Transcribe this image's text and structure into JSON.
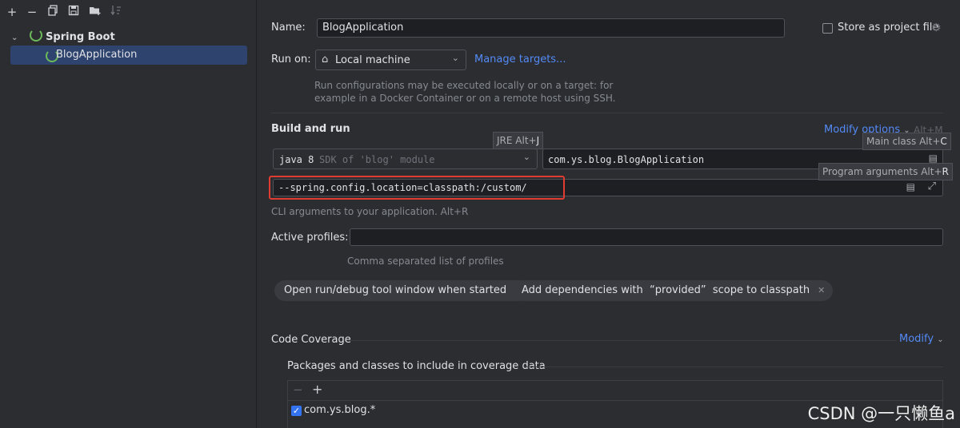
{
  "toolbar": {
    "add_icon": "+",
    "remove_icon": "−"
  },
  "tree": {
    "root_label": "Spring Boot",
    "child_label": "BlogApplication"
  },
  "form": {
    "name_label": "Name:",
    "name_value": "BlogApplication",
    "store_label": "Store as project file",
    "runon_label": "Run on:",
    "runon_value": "Local machine",
    "manage_targets": "Manage targets...",
    "runon_hint_line1": "Run configurations may be executed locally or on a target: for",
    "runon_hint_line2": "example in a Docker Container or on a remote host using SSH.",
    "build_title": "Build and run",
    "modify_options": "Modify options",
    "modify_shortcut": "Alt+M",
    "jre_tooltip_text": "JRE Alt+",
    "jre_tooltip_key": "J",
    "sdk_bold": "java 8",
    "sdk_hint": "SDK of 'blog' module",
    "main_class_value": "com.ys.blog.BlogApplication",
    "main_tooltip_text": "Main class Alt+",
    "main_tooltip_key": "C",
    "prog_tooltip_text": "Program arguments Alt+",
    "prog_tooltip_key": "R",
    "program_args_value": "--spring.config.location=classpath:/custom/",
    "cli_hint": "CLI arguments to your application. Alt+R",
    "profiles_label": "Active profiles:",
    "profiles_value": "",
    "profiles_hint": "Comma separated list of profiles",
    "chip1": "Open run/debug tool window when started",
    "chip2": "Add dependencies with  “provided”  scope to classpath",
    "coverage_title": "Code Coverage",
    "coverage_modify": "Modify",
    "packages_title": "Packages and classes to include in coverage data",
    "coverage_item": "com.ys.blog.*"
  },
  "watermark": "CSDN @一只懒鱼a",
  "colors": {
    "accent": "#548af7",
    "selection": "#2e436e",
    "highlight_box": "#e03c31"
  }
}
